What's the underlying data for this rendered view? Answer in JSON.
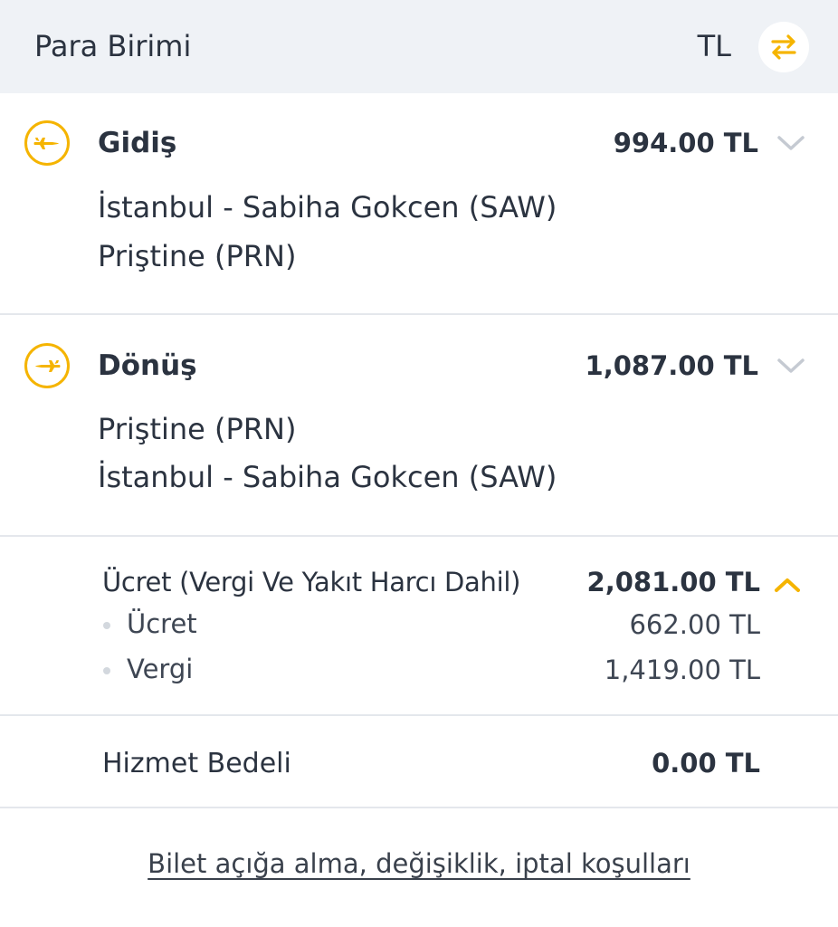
{
  "currency": {
    "label": "Para Birimi",
    "value": "TL",
    "swap_icon": "swap-arrows-icon",
    "accent": "#f5b400"
  },
  "legs": [
    {
      "icon": "plane-departure-icon",
      "title": "Gidiş",
      "price": "994.00 TL",
      "from": "İstanbul - Sabiha Gokcen (SAW)",
      "to": "Priştine (PRN)",
      "expanded": false
    },
    {
      "icon": "plane-return-icon",
      "title": "Dönüş",
      "price": "1,087.00 TL",
      "from": "Priştine (PRN)",
      "to": "İstanbul - Sabiha Gokcen (SAW)",
      "expanded": false
    }
  ],
  "fare": {
    "title": "Ücret (Vergi Ve Yakıt Harcı Dahil)",
    "total": "2,081.00 TL",
    "expanded": true,
    "items": [
      {
        "label": "Ücret",
        "value": "662.00 TL"
      },
      {
        "label": "Vergi",
        "value": "1,419.00 TL"
      }
    ]
  },
  "service": {
    "label": "Hizmet Bedeli",
    "value": "0.00 TL"
  },
  "conditions_link": "Bilet açığa alma, değişiklik, iptal koşulları",
  "colors": {
    "accent": "#f5b400",
    "header_bg": "#eff2f6",
    "text": "#2b3340",
    "chevron": "#c5cad2",
    "divider": "#e4e7ec"
  }
}
